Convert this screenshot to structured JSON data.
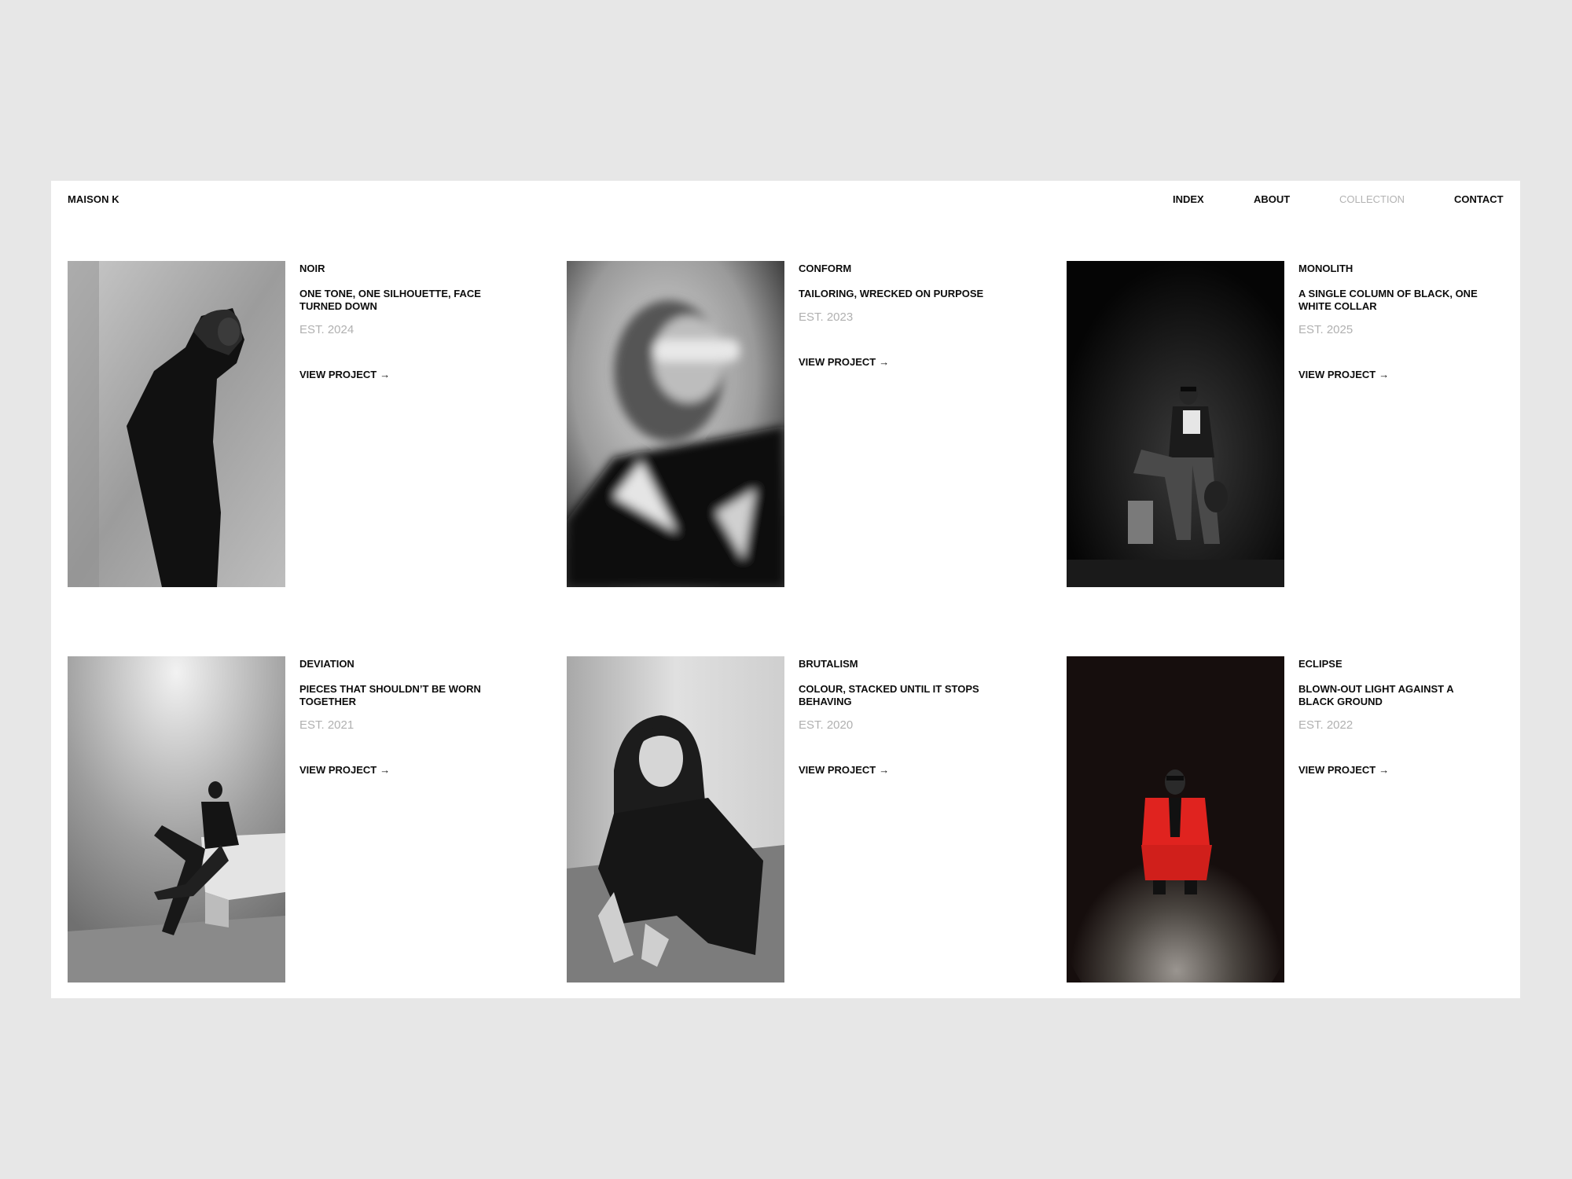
{
  "brand": "MAISON K",
  "nav": {
    "index": "INDEX",
    "about": "ABOUT",
    "collection": "COLLECTION",
    "contact": "CONTACT",
    "active": "COLLECTION"
  },
  "projects": [
    {
      "title": "NOIR",
      "description": "ONE TONE, ONE SILHOUETTE, FACE TURNED DOWN",
      "est": "EST. 2024",
      "cta": "VIEW PROJECT",
      "arrow": "→"
    },
    {
      "title": "CONFORM",
      "description": "TAILORING, WRECKED ON PURPOSE",
      "est": "EST. 2023",
      "cta": "VIEW PROJECT",
      "arrow": "→"
    },
    {
      "title": "MONOLITH",
      "description": "A SINGLE COLUMN OF BLACK, ONE WHITE COLLAR",
      "est": "EST. 2025",
      "cta": "VIEW PROJECT",
      "arrow": "→"
    },
    {
      "title": "DEVIATION",
      "description": "PIECES THAT SHOULDN’T BE WORN TOGETHER",
      "est": "EST. 2021",
      "cta": "VIEW PROJECT",
      "arrow": "→"
    },
    {
      "title": "BRUTALISM",
      "description": "COLOUR, STACKED UNTIL IT STOPS BEHAVING",
      "est": "EST. 2020",
      "cta": "VIEW PROJECT",
      "arrow": "→"
    },
    {
      "title": "ECLIPSE",
      "description": "BLOWN-OUT LIGHT AGAINST A BLACK GROUND",
      "est": "EST. 2022",
      "cta": "VIEW PROJECT",
      "arrow": "→"
    }
  ],
  "colors": {
    "background": "#e7e7e7",
    "panel": "#ffffff",
    "text": "#0d0d0d",
    "muted": "#b0b0b0",
    "accent_red": "#e0231f"
  }
}
